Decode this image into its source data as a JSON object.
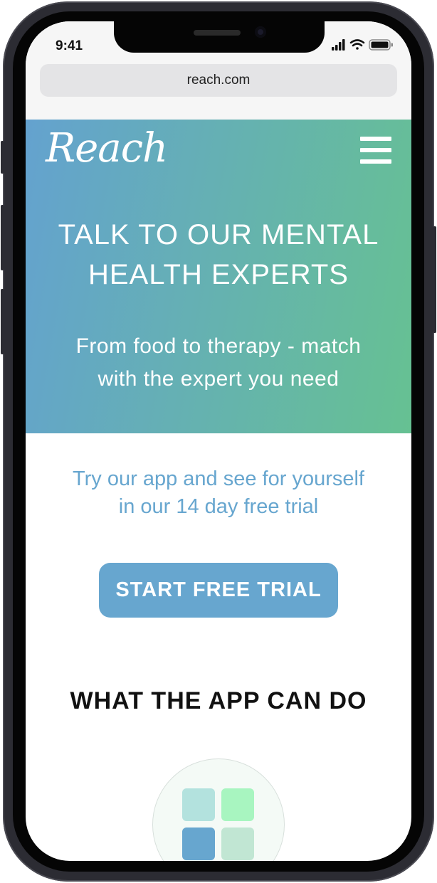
{
  "status_bar": {
    "time": "9:41"
  },
  "browser": {
    "url": "reach.com"
  },
  "header": {
    "logo": "Reach",
    "menu_icon": "hamburger-menu-icon"
  },
  "hero": {
    "title_line1": "TALK TO OUR MENTAL",
    "title_line2": "HEALTH EXPERTS",
    "subtitle_line1": "From food to therapy - match",
    "subtitle_line2": "with the expert you need"
  },
  "trial": {
    "line1": "Try our app and see for yourself",
    "line2": "in our 14 day free trial",
    "cta_label": "START FREE TRIAL"
  },
  "features": {
    "title": "WHAT THE APP CAN DO",
    "icon": "app-grid-icon"
  },
  "colors": {
    "gradient_start": "#64a2cf",
    "gradient_end": "#66c192",
    "accent": "#67a6cf",
    "tile_colors": [
      "#b3e2de",
      "#a8f5c0",
      "#67a6cf",
      "#c1e6d3"
    ]
  }
}
